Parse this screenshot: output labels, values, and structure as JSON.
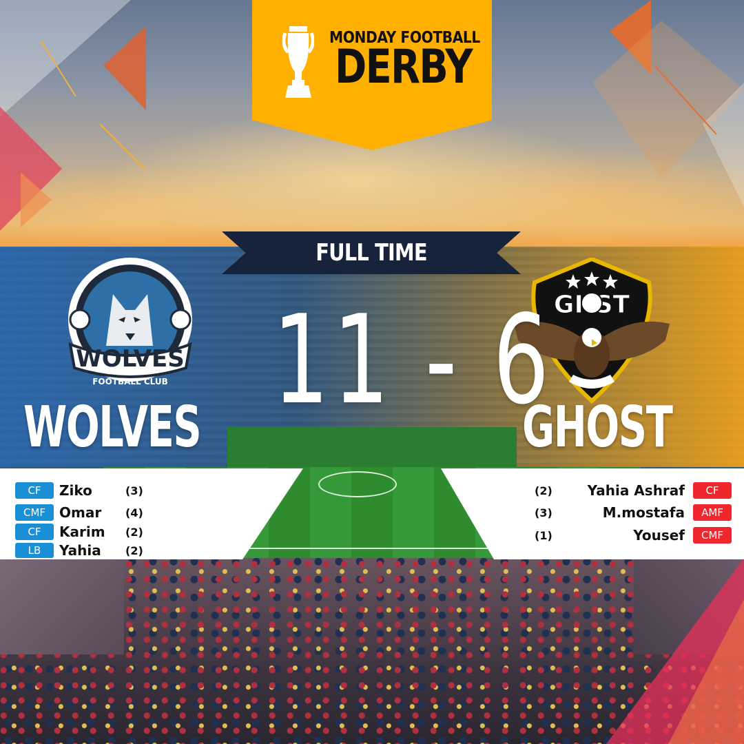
{
  "header": {
    "subtitle": "MONDAY FOOTBALL",
    "title": "DERBY",
    "icon": "trophy-icon",
    "color": "#ffb000"
  },
  "status": {
    "label": "FULL TIME",
    "color": "#17233a"
  },
  "score": {
    "display": "11 - 6",
    "home": 11,
    "away": 6
  },
  "home_team": {
    "name": "WOLVES",
    "logo": {
      "main_text": "WOLVES",
      "sub_text": "FOOTBALL CLUB",
      "icon": "wolf-crest-icon"
    },
    "accent": "#1a8fd6",
    "scorers": [
      {
        "pos": "CF",
        "name": "Ziko",
        "goals": "(3)"
      },
      {
        "pos": "CMF",
        "name": "Omar",
        "goals": "(4)"
      },
      {
        "pos": "CF",
        "name": "Karim",
        "goals": "(2)"
      },
      {
        "pos": "LB",
        "name": "Yahia",
        "goals": "(2)"
      }
    ]
  },
  "away_team": {
    "name": "GHOST",
    "logo": {
      "main_text": "GHST",
      "icon": "eagle-shield-icon"
    },
    "accent": "#f0262e",
    "scorers": [
      {
        "pos": "CF",
        "name": "Yahia Ashraf",
        "goals": "(2)"
      },
      {
        "pos": "AMF",
        "name": "M.mostafa",
        "goals": "(3)"
      },
      {
        "pos": "CMF",
        "name": "Yousef",
        "goals": "(1)"
      }
    ]
  }
}
